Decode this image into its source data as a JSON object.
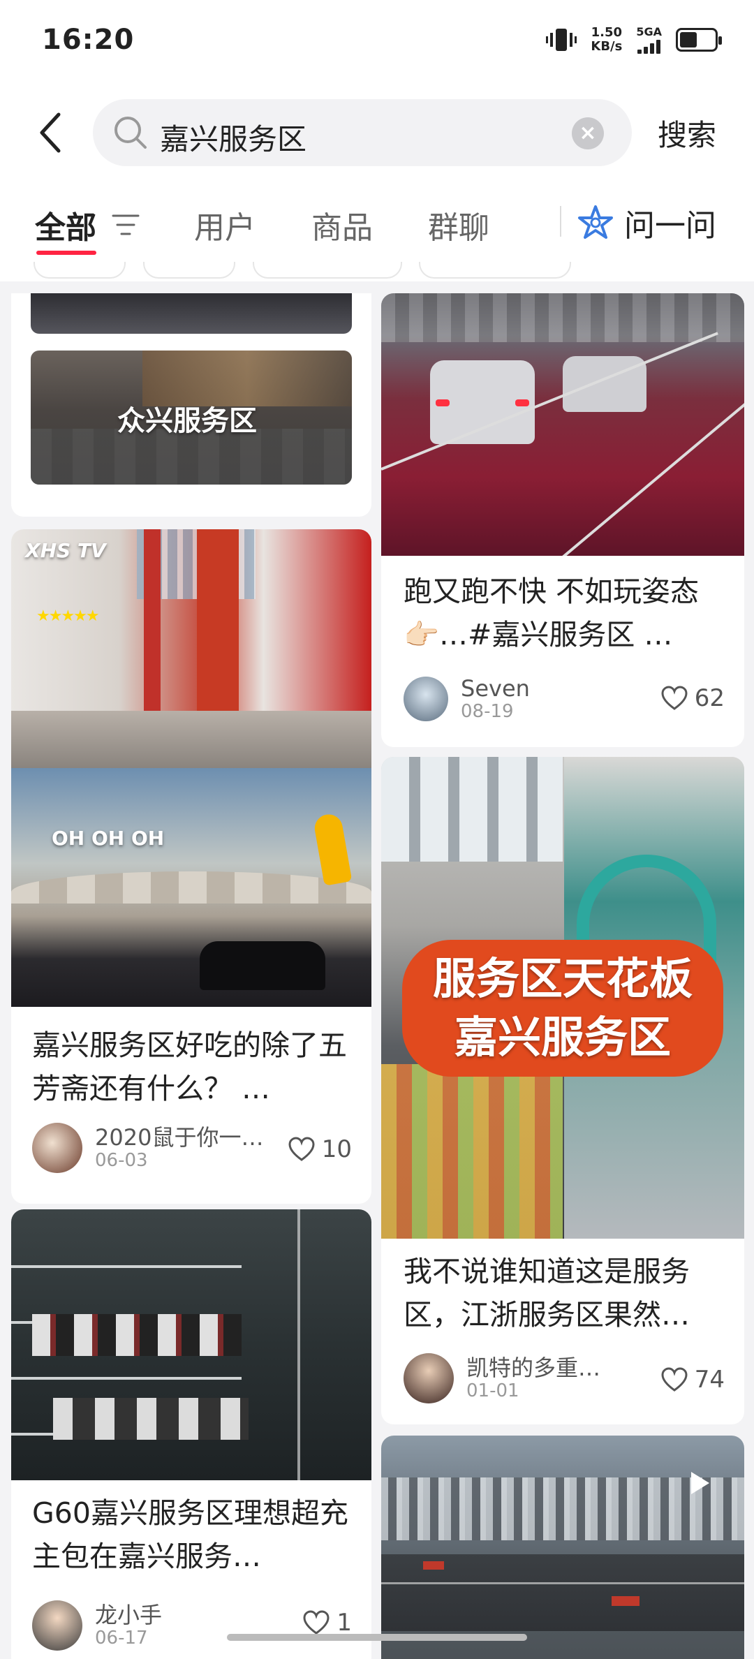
{
  "status_bar": {
    "time": "16:20",
    "net_speed": "1.50",
    "net_unit": "KB/s",
    "signal": "5GA",
    "battery_level": 0.45
  },
  "search": {
    "query": "嘉兴服务区",
    "search_button": "搜索"
  },
  "tabs": [
    {
      "label": "全部",
      "active": true
    },
    {
      "label": "用户"
    },
    {
      "label": "商品"
    },
    {
      "label": "群聊"
    }
  ],
  "ask_label": "问一问",
  "accent_color": "#ff2442",
  "cards": {
    "left_top": {
      "overlay": "众兴服务区"
    },
    "right_top": {
      "title": "跑又跑不快 不如玩姿态👉🏻…#嘉兴服务区 …",
      "author": "Seven",
      "date": "08-19",
      "likes": "62"
    },
    "left_mid": {
      "overlay_brand": "XHS TV",
      "overlay_text": "OH OH OH",
      "title": "嘉兴服务区好吃的除了五芳斋还有什么？ …",
      "author": "2020鼠于你一…",
      "date": "06-03",
      "likes": "10"
    },
    "right_mid": {
      "banner_line1": "服务区天花板",
      "banner_line2": "嘉兴服务区",
      "title": "我不说谁知道这是服务区，江浙服务区果然…",
      "author": "凯特的多重…",
      "date": "01-01",
      "likes": "74"
    },
    "left_bottom": {
      "title": "G60嘉兴服务区理想超充 主包在嘉兴服务…",
      "author": "龙小手",
      "date": "06-17",
      "likes": "1"
    }
  }
}
